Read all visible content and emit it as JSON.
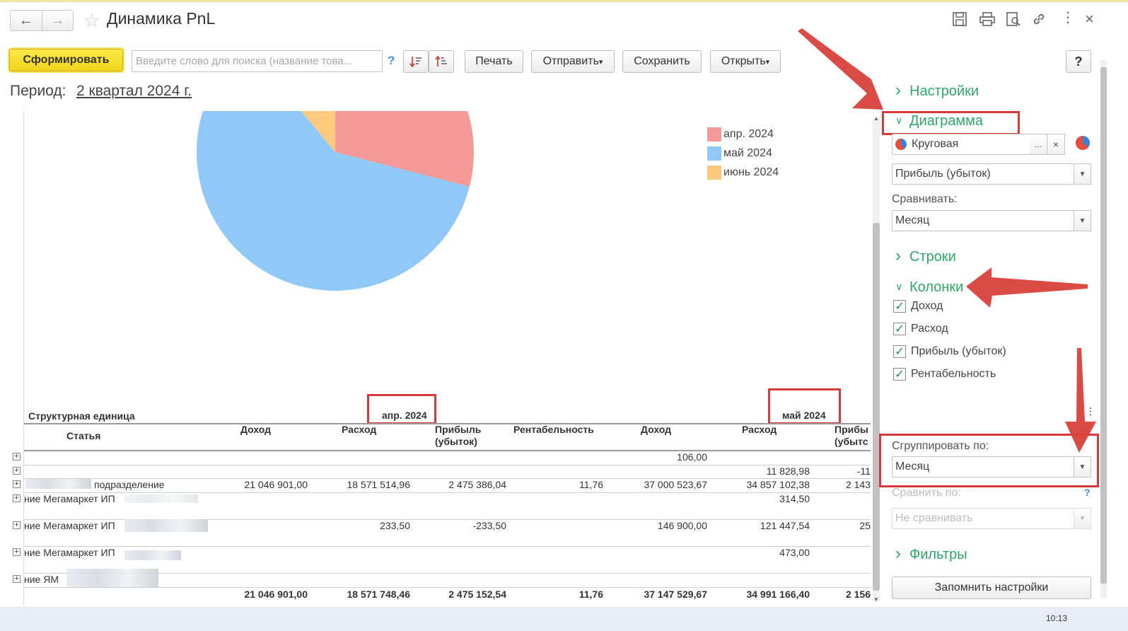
{
  "window": {
    "title": "Динамика PnL",
    "back_icon": "arrow-left",
    "forward_icon": "arrow-right",
    "favorite_icon": "star-outline"
  },
  "toolbar": {
    "generate_label": "Сформировать",
    "search_placeholder": "Введите слово для поиска (название това...",
    "search_help": "?",
    "print_label": "Печать",
    "send_label": "Отправить",
    "save_label": "Сохранить",
    "open_label": "Открыть",
    "help_label": "?"
  },
  "period": {
    "label": "Период:",
    "value": "2 квартал 2024 г."
  },
  "chart_data": {
    "type": "pie",
    "categories": [
      "апр. 2024",
      "май 2024",
      "июнь 2024"
    ],
    "values": [
      29,
      60,
      11
    ],
    "colors": [
      "#f59a98",
      "#90c8f8",
      "#fdc97c"
    ],
    "legend": "top-right"
  },
  "table": {
    "group_header": "Структурная единица",
    "row_header": "Статья",
    "periods": [
      "апр. 2024",
      "май 2024"
    ],
    "columns": [
      "Доход",
      "Расход",
      "Прибыль\n(убыток)",
      "Рентабельность",
      "Доход",
      "Расход",
      "Прибы\n(убытс"
    ],
    "rows": [
      {
        "label": "",
        "values": [
          "",
          "",
          "",
          "",
          "106,00",
          "",
          ""
        ]
      },
      {
        "label": "",
        "values": [
          "",
          "",
          "",
          "",
          "",
          "11 828,98",
          "-11"
        ]
      },
      {
        "label": "подразделение",
        "values": [
          "21 046 901,00",
          "18 571 514,96",
          "2 475 386,04",
          "11,76",
          "37 000 523,67",
          "34 857 102,38",
          "2 143"
        ]
      },
      {
        "label": "ние Мегамаркет ИП",
        "values": [
          "",
          "",
          "",
          "",
          "",
          "314,50",
          ""
        ]
      },
      {
        "label": "ние Мегамаркет ИП",
        "values": [
          "",
          "233,50",
          "-233,50",
          "",
          "146 900,00",
          "121 447,54",
          "25"
        ]
      },
      {
        "label": "ние Мегамаркет ИП",
        "values": [
          "",
          "",
          "",
          "",
          "",
          "473,00",
          ""
        ]
      },
      {
        "label": "ние ЯМ",
        "values": [
          "",
          "",
          "",
          "",
          "",
          "",
          ""
        ]
      }
    ],
    "totals": [
      "21 046 901,00",
      "18 571 748,46",
      "2 475 152,54",
      "11,76",
      "37 147 529,67",
      "34 991 166,40",
      "2 156"
    ]
  },
  "panel": {
    "settings": "Настройки",
    "chart": "Диаграмма",
    "chart_type": "Круговая",
    "chart_indicator": "Прибыль (убыток)",
    "compare_label": "Сравнивать:",
    "compare_value": "Месяц",
    "rows": "Строки",
    "columns": "Колонки",
    "column_items": [
      {
        "label": "Доход",
        "checked": true
      },
      {
        "label": "Расход",
        "checked": true
      },
      {
        "label": "Прибыль (убыток)",
        "checked": true
      },
      {
        "label": "Рентабельность",
        "checked": true
      }
    ],
    "group_by_label": "Сгруппировать по:",
    "group_by_value": "Месяц",
    "compare_by_label": "Сравнить по:",
    "compare_by_help": "?",
    "compare_by_value": "Не сравнивать",
    "filters": "Фильтры",
    "remember_label": "Запомнить настройки"
  },
  "taskbar": {
    "clock": "10:13"
  }
}
